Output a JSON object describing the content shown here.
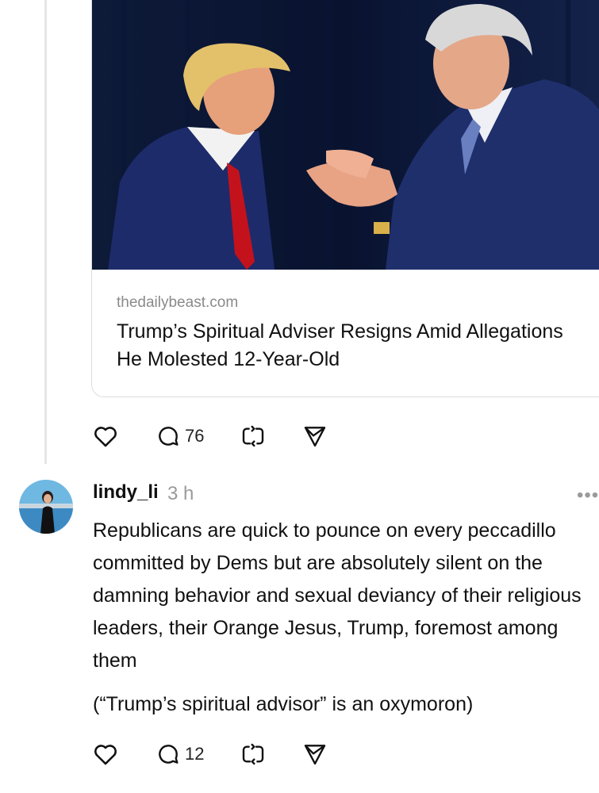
{
  "link_card": {
    "domain": "thedailybeast.com",
    "title": "Trump’s Spiritual Adviser Resigns Amid Allegations He Molested 12-Year-Old"
  },
  "post1_actions": {
    "reply_count": "76",
    "icons": [
      "heart-icon",
      "comment-icon",
      "repost-icon",
      "share-icon"
    ]
  },
  "post2": {
    "username": "lindy_li",
    "time": "3 h",
    "more": "•••",
    "body": "Republicans are quick to pounce on every peccadillo committed by Dems but are absolutely silent on the damning behavior and sexual deviancy of their religious leaders, their Orange Jesus, Trump, foremost among them",
    "note": "(“Trump’s spiritual advisor” is an oxymoron)",
    "actions": {
      "reply_count": "12"
    }
  },
  "colors": {
    "text": "#111111",
    "muted": "#8a8a8a",
    "border": "#dcdcdc"
  }
}
